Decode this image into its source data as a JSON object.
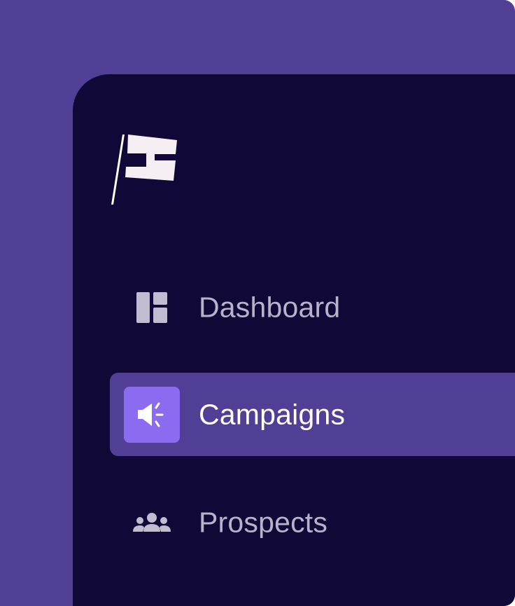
{
  "app": {
    "logo_icon": "flag-logo-icon"
  },
  "nav": {
    "items": [
      {
        "label": "Dashboard",
        "icon": "dashboard-icon",
        "active": false
      },
      {
        "label": "Campaigns",
        "icon": "megaphone-icon",
        "active": true
      },
      {
        "label": "Prospects",
        "icon": "people-icon",
        "active": false
      }
    ]
  },
  "colors": {
    "outer_background": "#513f96",
    "sidebar_background": "#100836",
    "active_item_background": "#513f96",
    "active_icon_background": "#8b6cf1",
    "inactive_text": "#b9b3c9",
    "active_text": "#ffffff"
  }
}
